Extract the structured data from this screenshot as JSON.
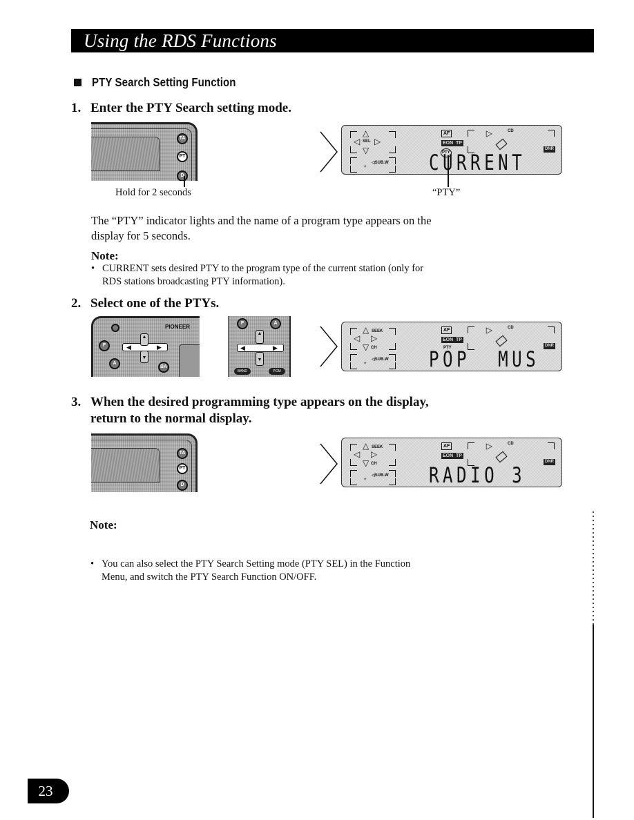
{
  "header": {
    "title": "Using the RDS Functions"
  },
  "section": {
    "title": "PTY Search Setting Function"
  },
  "steps": [
    {
      "number": "1.",
      "text": "Enter the PTY Search setting mode."
    },
    {
      "number": "2.",
      "text": "Select one of the PTYs."
    },
    {
      "number": "3.",
      "line1": "When the desired programming type appears on the display,",
      "line2": "return to the normal display."
    }
  ],
  "step1": {
    "caption_left": "Hold for 2 seconds",
    "caption_right": "“PTY”",
    "unit_buttons": [
      "TA",
      "PT",
      "D"
    ],
    "body_line1": "The “PTY” indicator lights and the name of a program type appears on the",
    "body_line2": "display for 5 seconds.",
    "note_heading": "Note:",
    "note_bullet": "•",
    "note_line1": "CURRENT sets desired PTY to the program type of the current station (only for",
    "note_line2": "RDS stations broadcasting PTY information)."
  },
  "step2": {
    "brand": "PIONEER",
    "unit_buttons": [
      "F",
      "A",
      "BA"
    ],
    "remote_buttons": [
      "F",
      "A",
      "BAND",
      "PGM"
    ]
  },
  "step3": {
    "unit_buttons": [
      "TA",
      "PT",
      "D"
    ]
  },
  "displays": [
    {
      "text": "CURRENT",
      "nav_label": "SEL",
      "sub_label": "◁SUB.W",
      "af": "AF",
      "eon": "EON",
      "tp": "TP",
      "pty": "PTY",
      "pty_style": "circled",
      "cd": "CD",
      "right_badge": "DNR"
    },
    {
      "text": "POP  MUS",
      "nav_label": "SEEK",
      "nav_label2": "CH",
      "sub_label": "◁SUB.W",
      "af": "AF",
      "eon": "EON",
      "tp": "TP",
      "pty": "PTY",
      "pty_style": "plain",
      "cd": "CD",
      "right_badge": "DNR"
    },
    {
      "text": "RADIO 3",
      "nav_label": "SEEK",
      "nav_label2": "CH",
      "sub_label": "◁SUB.W",
      "af": "AF",
      "eon": "EON",
      "tp": "TP",
      "cd": "CD",
      "right_badge": "DNR"
    }
  ],
  "final_note": {
    "heading": "Note:",
    "bullet": "•",
    "line1": "You can also select the PTY Search Setting mode (PTY SEL) in the Function",
    "line2": "Menu, and switch the PTY Search Function ON/OFF."
  },
  "footer": {
    "page_number": "23"
  },
  "icons": {
    "section_marker": "black-square-icon",
    "step_arrow": "right-triangle-outline-icon",
    "nav_arrows": "four-way-arrow-icon",
    "antenna": "antenna-icon",
    "cd": "cd-icon"
  }
}
